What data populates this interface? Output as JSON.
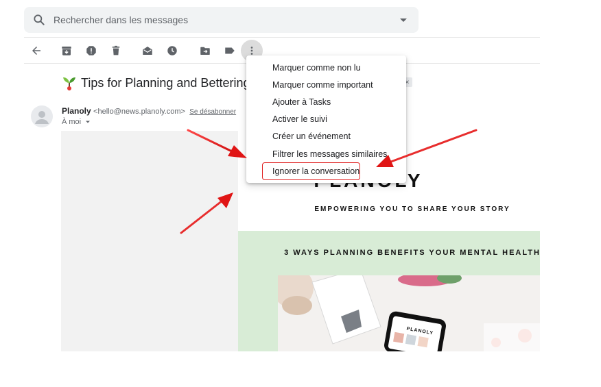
{
  "search": {
    "placeholder": "Rechercher dans les messages"
  },
  "toolbar": {
    "icons": [
      "back-arrow-icon",
      "archive-icon",
      "report-spam-icon",
      "delete-icon",
      "mark-unread-icon",
      "snooze-icon",
      "move-to-icon",
      "label-icon",
      "more-vert-icon"
    ]
  },
  "message": {
    "subject": "Tips for Planning and Bettering",
    "sender_name": "Planoly",
    "sender_email": "<hello@news.planoly.com>",
    "unsubscribe": "Se désabonner",
    "recipient": "À moi",
    "tag_close": "×"
  },
  "email_body": {
    "brand": "PLANOLY",
    "tagline": "EMPOWERING YOU TO SHARE YOUR STORY",
    "headline": "3 WAYS PLANNING BENEFITS YOUR MENTAL HEALTH",
    "phone_brand": "PLANOLY"
  },
  "menu": {
    "items": [
      "Marquer comme non lu",
      "Marquer comme important",
      "Ajouter à Tasks",
      "Activer le suivi",
      "Créer un événement",
      "Filtrer les messages similaires",
      "Ignorer la conversation"
    ],
    "highlighted_index": 6
  },
  "colors": {
    "annotation_red": "#e02020",
    "green_band": "#d8ecd6",
    "menu_hover": "#dcdcdc"
  }
}
